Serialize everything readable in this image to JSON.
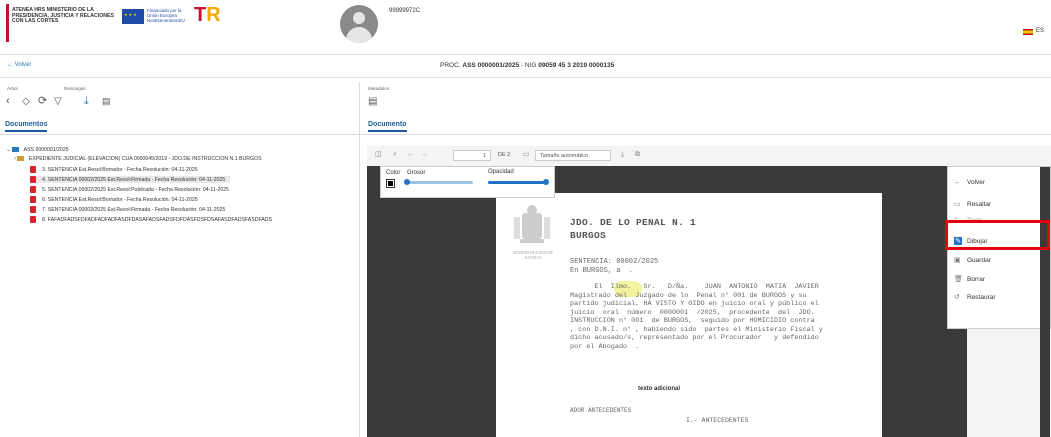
{
  "header": {
    "ministry": "ATENEA HRS MINISTERIO DE LA PRESIDENCIA, JUSTICIA Y RELACIONES CON LAS CORTES",
    "eu_text": "Financiado por la Unión Europea NextGenerationEU",
    "prtr": "PRTR",
    "user_id": "99999972C",
    "language": "ES"
  },
  "subheader": {
    "back_label": "← Volver",
    "proc_prefix": "PROC. ",
    "proc_number": "ASS 0000001/2025",
    "nig_prefix": " - NIG ",
    "nig_number": "09059 45 3 2019 0000135"
  },
  "left": {
    "arbol_label": "Árbol",
    "descargas_label": "Descargas",
    "tab_label": "Documentos",
    "tree": {
      "root": "ASS 0000001/2025",
      "folder": "EXPEDIENTE JUDICIAL (ELEVACION) CUA 0000045/2019 - JDO.DE INSTRUCCION N.1 BURGOS",
      "docs": [
        "3. SENTENCIA Est.Resol:Borrador - Fecha Resolución: 04-11-2025",
        "4. SENTENCIA 00002/2025 Est.Resol:Firmada - Fecha Resolución: 04-11-2025",
        "5. SENTENCIA 00002/2025 Est.Resol:Publicada - Fecha Resolución: 04-11-2025",
        "6. SENTENCIA Est.Resol:Borrador - Fecha Resolución: 04-11-2025",
        "7. SENTENCIA 00003/2025 Est.Resol:Firmada - Fecha Resolución: 04-11-2025",
        "8. FAFADFADSFDFADFADFADFASDFDASAFADSFADSFDFDASFDSFDSAFASDFADSFASDFADS"
      ]
    }
  },
  "right": {
    "metadatos_label": "Metadatos",
    "tab_label": "Documento",
    "viewer": {
      "page_number": "1",
      "page_total": "DE 2",
      "zoom": "Tamaño automático"
    },
    "draw_panel": {
      "color_label": "Color",
      "grosor_label": "Grosor",
      "opacidad_label": "Opacidad",
      "grosor_level": 0.0,
      "opacidad_level": 1.0
    },
    "doc": {
      "heading1": "JDO. DE LO PENAL N. 1",
      "heading2": "BURGOS",
      "admin": "ADMINISTRACION DE JUSTICIA",
      "sentencia": "SENTENCIA: 00002/2025",
      "lugar": "En BURGOS, a  .",
      "body": "      El  Ilmo.   Sr.   D/Ña.    JUAN  ANTONIO  MATIA  JAVIER\nMagistrado del  Juzgado de lo  Penal n° 001 de BURGOS y su\npartido judicial, HA VISTO Y OIDO en juicio oral y público el\njuicio  oral  número  0000001  /2025,  procedente  del  JDO.\nINSTRUCCION n° 001  de BURGOS,  seguido por HOMICIDIO contra\n, con D.N.I. n° , habiendo sido  partes el Ministerio Fiscal y\ndicho acusado/s, representado por el Procurador   y defendido\npor el Abogado  .",
      "texto_adicional": "texto adicional",
      "ador": "ADOR ANTECEDENTES",
      "antecedentes": "I.- ANTECEDENTES"
    },
    "side_menu": [
      {
        "icon": "back-icon",
        "label": "Volver"
      },
      {
        "icon": "highlight-icon",
        "label": "Resaltar"
      },
      {
        "icon": "text-icon",
        "label": "Texto"
      },
      {
        "icon": "pen-icon",
        "label": "Dibujar"
      },
      {
        "icon": "save-icon",
        "label": "Guardar"
      },
      {
        "icon": "trash-icon",
        "label": "Borrar"
      },
      {
        "icon": "restore-icon",
        "label": "Restaurar"
      }
    ]
  },
  "colors": {
    "accent": "#1c5d99",
    "highlight_box": "#e3000f",
    "pdf_icon": "#d9232e"
  }
}
